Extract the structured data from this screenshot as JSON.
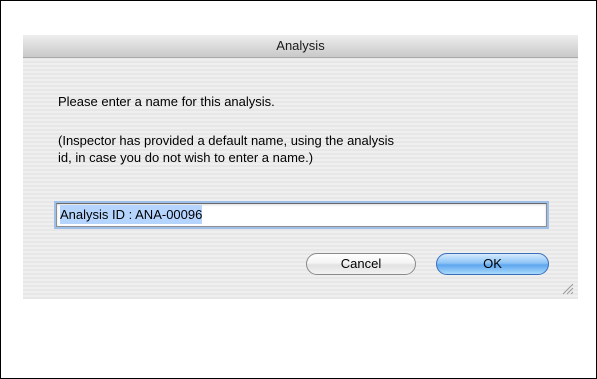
{
  "dialog": {
    "title": "Analysis",
    "message": "Please enter a name for this analysis.",
    "note_line1": "(Inspector has provided a default name, using the analysis",
    "note_line2": "id, in case you do not wish to enter a name.)",
    "name_field": {
      "value": "Analysis ID : ANA-00096"
    },
    "cancel_label": "Cancel",
    "ok_label": "OK"
  },
  "colors": {
    "ok_button": "#5ea6ef",
    "selection": "#b5d5ff",
    "focus_ring": "#9ebfe9"
  },
  "icons": {
    "resize": "resize-grip-icon"
  }
}
